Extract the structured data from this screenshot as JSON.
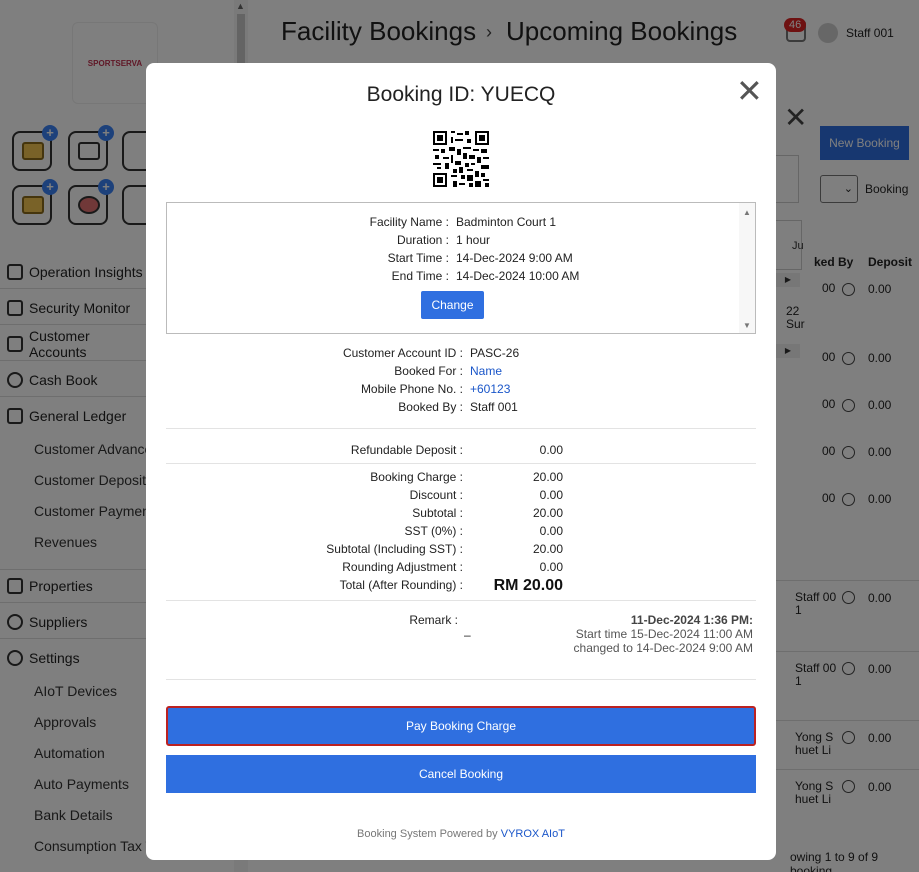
{
  "app": {
    "logo_text": "SPORTSERVA",
    "breadcrumb": {
      "parent": "Facility Bookings",
      "current": "Upcoming Bookings"
    },
    "notification_count": "46",
    "user_name": "Staff 001"
  },
  "sidebar": {
    "items": [
      {
        "label": "Operation Insights"
      },
      {
        "label": "Security Monitor"
      },
      {
        "label": "Customer Accounts"
      },
      {
        "label": "Cash Book"
      },
      {
        "label": "General Ledger"
      },
      {
        "label": "Properties"
      },
      {
        "label": "Suppliers"
      },
      {
        "label": "Settings"
      }
    ],
    "general_ledger_sub": [
      "Customer Advances",
      "Customer Deposits",
      "Customer Payments",
      "Revenues"
    ],
    "settings_sub": [
      "AIoT Devices",
      "Approvals",
      "Automation",
      "Auto Payments",
      "Bank Details",
      "Consumption Tax T"
    ]
  },
  "background_list": {
    "new_booking_label": "New Booking",
    "select_value": "",
    "select_label": "Booking",
    "tab_fragment": "Ju",
    "col_booked_by": "ked By",
    "col_deposit": "Deposit",
    "date_fragment_1": "22",
    "date_fragment_2": "Sur",
    "rows": [
      {
        "by": "",
        "deposit": "0.00"
      },
      {
        "by": "",
        "deposit": "0.00"
      },
      {
        "by": "",
        "deposit": "0.00"
      },
      {
        "by": "",
        "deposit": "0.00"
      },
      {
        "by": "",
        "deposit": "0.00"
      },
      {
        "by": "Staff 00 1",
        "deposit": "0.00"
      },
      {
        "by": "Staff 00 1",
        "deposit": "0.00"
      },
      {
        "by": "Yong S huet Li",
        "deposit": "0.00"
      },
      {
        "by": "Yong S huet Li",
        "deposit": "0.00"
      }
    ],
    "back_col_values": [
      "00",
      "00",
      "00",
      "00",
      "00"
    ],
    "showing_text": "owing 1 to 9 of 9 booking"
  },
  "modal": {
    "title": "Booking ID: YUECQ",
    "facility": {
      "name_label": "Facility Name :",
      "name": "Badminton Court 1",
      "duration_label": "Duration :",
      "duration": "1 hour",
      "start_label": "Start Time :",
      "start": "14-Dec-2024 9:00 AM",
      "end_label": "End Time :",
      "end": "14-Dec-2024 10:00 AM",
      "change_label": "Change"
    },
    "customer": {
      "account_label": "Customer Account ID :",
      "account": "PASC-26",
      "for_label": "Booked For :",
      "for": "Name",
      "phone_label": "Mobile Phone No. :",
      "phone": "+60123",
      "by_label": "Booked By :",
      "by": "Staff 001"
    },
    "charges": {
      "deposit_label": "Refundable Deposit :",
      "deposit": "0.00",
      "booking_charge_label": "Booking Charge :",
      "booking_charge": "20.00",
      "discount_label": "Discount :",
      "discount": "0.00",
      "subtotal_label": "Subtotal :",
      "subtotal": "20.00",
      "sst_label": "SST (0%) :",
      "sst": "0.00",
      "subtotal_sst_label": "Subtotal (Including SST) :",
      "subtotal_sst": "20.00",
      "rounding_label": "Rounding Adjustment :",
      "rounding": "0.00",
      "total_label": "Total (After Rounding) :",
      "total": "RM 20.00"
    },
    "remark": {
      "label": "Remark :",
      "value": "–",
      "log_time": "11-Dec-2024 1:36 PM:",
      "log_line1": "Start time 15-Dec-2024 11:00 AM",
      "log_line2": "changed to 14-Dec-2024 9:00 AM"
    },
    "pay_label": "Pay Booking Charge",
    "cancel_label": "Cancel Booking",
    "powered_prefix": "Booking System Powered by",
    "powered_brand": "VYROX AIoT"
  }
}
